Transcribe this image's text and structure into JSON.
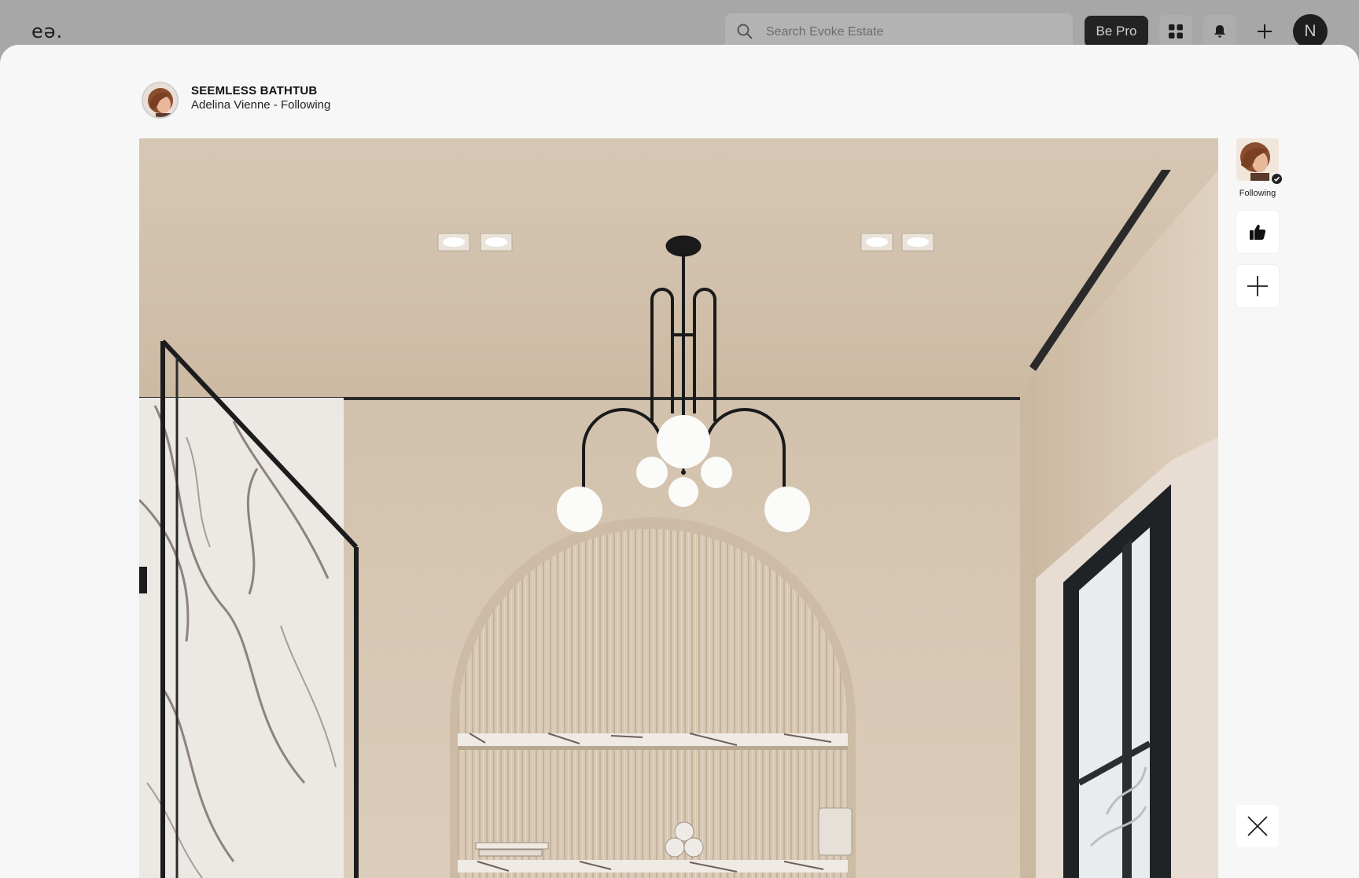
{
  "topbar": {
    "logo": "eə.",
    "search_placeholder": "Search Evoke Estate",
    "pro_label": "Be Pro",
    "user_initial": "N",
    "icons": [
      "search-icon",
      "apps-grid-icon",
      "bell-icon",
      "plus-icon"
    ]
  },
  "post": {
    "title": "SEEMLESS BATHTUB",
    "subtitle": "Adelina Vienne - Following"
  },
  "rail": {
    "following_label": "Following",
    "icons": [
      "verified-check-icon",
      "thumbs-up-icon",
      "plus-icon",
      "close-icon"
    ]
  },
  "colors": {
    "topbar_bg": "#a7a7a7",
    "modal_bg": "#f7f7f7",
    "pro_button_bg": "#232323",
    "wall": "#d9cbb8"
  }
}
